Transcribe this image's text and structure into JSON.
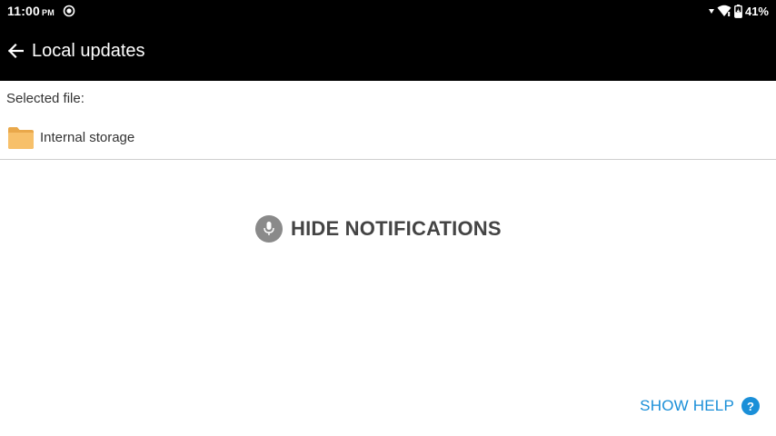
{
  "status_bar": {
    "time": "11:00",
    "ampm": "PM",
    "battery_percent": "41%",
    "icons": [
      "cast-icon",
      "signal-down-icon",
      "wifi-icon",
      "battery-charging-icon"
    ]
  },
  "app_bar": {
    "title": "Local updates",
    "back_icon": "back-arrow-icon"
  },
  "file_picker": {
    "selected_label": "Selected file:",
    "location_label": "Internal storage",
    "location_icon": "folder-icon"
  },
  "actions": {
    "hide_notifications_label": "HIDE NOTIFICATIONS",
    "hide_notifications_icon": "microphone-icon",
    "show_help_label": "SHOW HELP",
    "show_help_icon": "help-icon"
  },
  "colors": {
    "app_bar_bg": "#000000",
    "accent": "#1a8fd8",
    "folder": "#f5b85a"
  }
}
